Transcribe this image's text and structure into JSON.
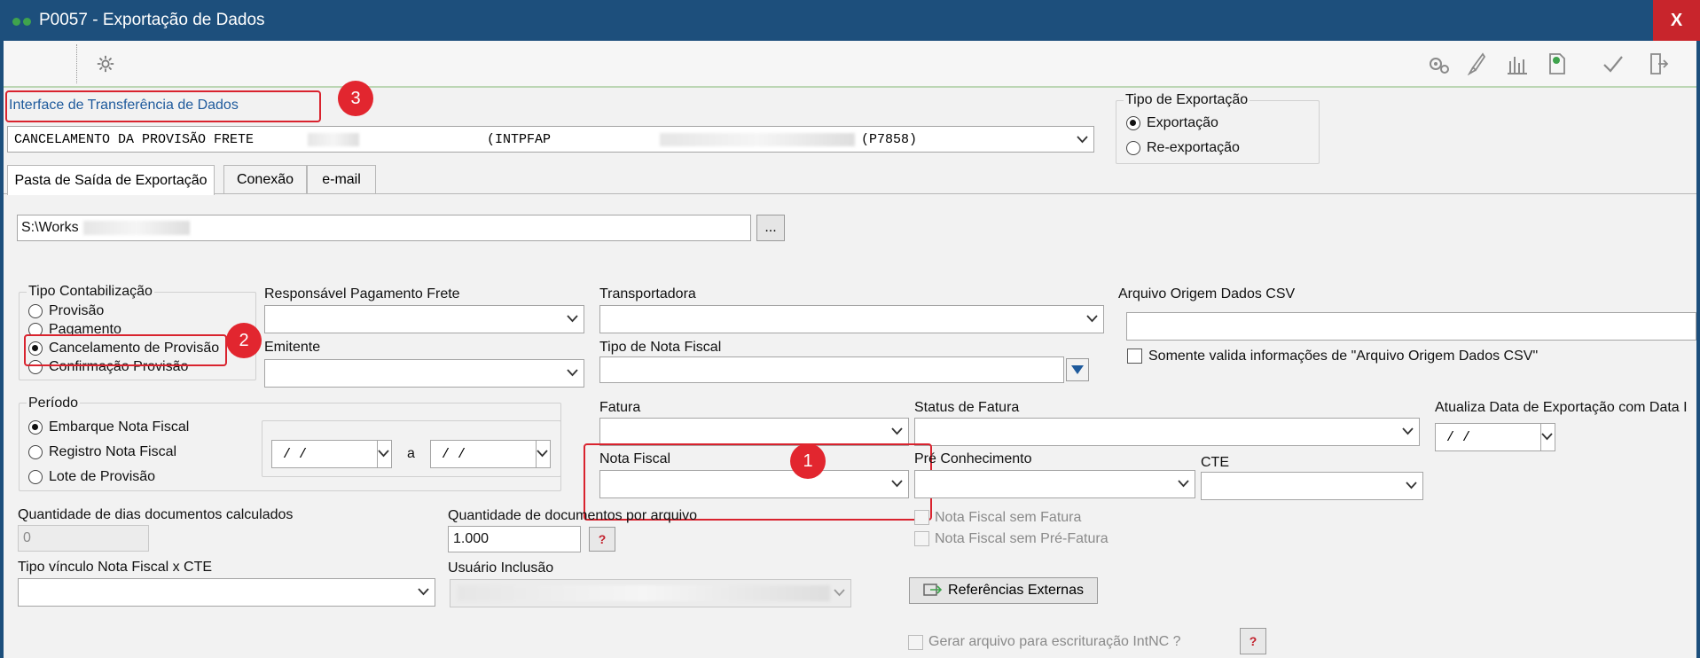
{
  "window": {
    "title": "P0057 - Exportação de Dados",
    "close_label": "X"
  },
  "toolbar": {
    "left_icon": "gear-icon",
    "right_icons": [
      "gears-icon",
      "brush-icon",
      "chart-bars-icon",
      "document-money-icon",
      "check-icon",
      "exit-icon"
    ]
  },
  "interface": {
    "label": "Interface de Transferência de Dados",
    "value_part1": "CANCELAMENTO DA PROVISÃO FRETE",
    "value_part2": "(INTPFAP",
    "value_part3": "(P7858)"
  },
  "tipo_exportacao": {
    "title": "Tipo de Exportação",
    "options": [
      "Exportação",
      "Re-exportação"
    ],
    "selected": "Exportação"
  },
  "tabs": [
    "Pasta de Saída de Exportação",
    "Conexão",
    "e-mail"
  ],
  "output_path": {
    "value": "S:\\Works",
    "browse_label": "..."
  },
  "tipo_contabilizacao": {
    "title": "Tipo Contabilização",
    "options": [
      "Provisão",
      "Pagamento",
      "Cancelamento de Provisão",
      "Confirmação Provisão"
    ],
    "selected": "Cancelamento de Provisão"
  },
  "labels": {
    "responsavel": "Responsável Pagamento Frete",
    "emitente": "Emitente",
    "transportadora": "Transportadora",
    "tipo_nf": "Tipo de Nota Fiscal",
    "arquivo_csv": "Arquivo Origem Dados CSV",
    "somente_csv": "Somente valida informações de \"Arquivo Origem Dados CSV\"",
    "fatura": "Fatura",
    "status_fatura": "Status de Fatura",
    "atualiza_data": "Atualiza Data de Exportação com Data I",
    "nota_fiscal": "Nota Fiscal",
    "pre_conhecimento": "Pré Conhecimento",
    "cte": "CTE",
    "nf_sem_fatura": "Nota Fiscal sem Fatura",
    "nf_sem_pre_fatura": "Nota Fiscal sem Pré-Fatura",
    "qtd_dias": "Quantidade de dias documentos calculados",
    "qtd_docs": "Quantidade de documentos por arquivo",
    "tipo_vinculo": "Tipo vínculo Nota Fiscal x CTE",
    "usuario_inclusao": "Usuário Inclusão",
    "referencias": "Referências Externas",
    "gerar_arquivo": "Gerar arquivo para escrituração IntNC ?",
    "help": "?"
  },
  "periodo": {
    "title": "Período",
    "options": [
      "Embarque Nota Fiscal",
      "Registro Nota Fiscal",
      "Lote de Provisão"
    ],
    "selected": "Embarque Nota Fiscal",
    "date_from": "/ /",
    "sep": "a",
    "date_to": "/ /"
  },
  "values": {
    "qtd_dias": "0",
    "qtd_docs": "1.000",
    "atualiza_date": "/ /"
  },
  "annotations": [
    "1",
    "2",
    "3"
  ],
  "colors": {
    "titlebar": "#1d4f7c",
    "close": "#c8252c",
    "annotation": "#e2262f"
  }
}
